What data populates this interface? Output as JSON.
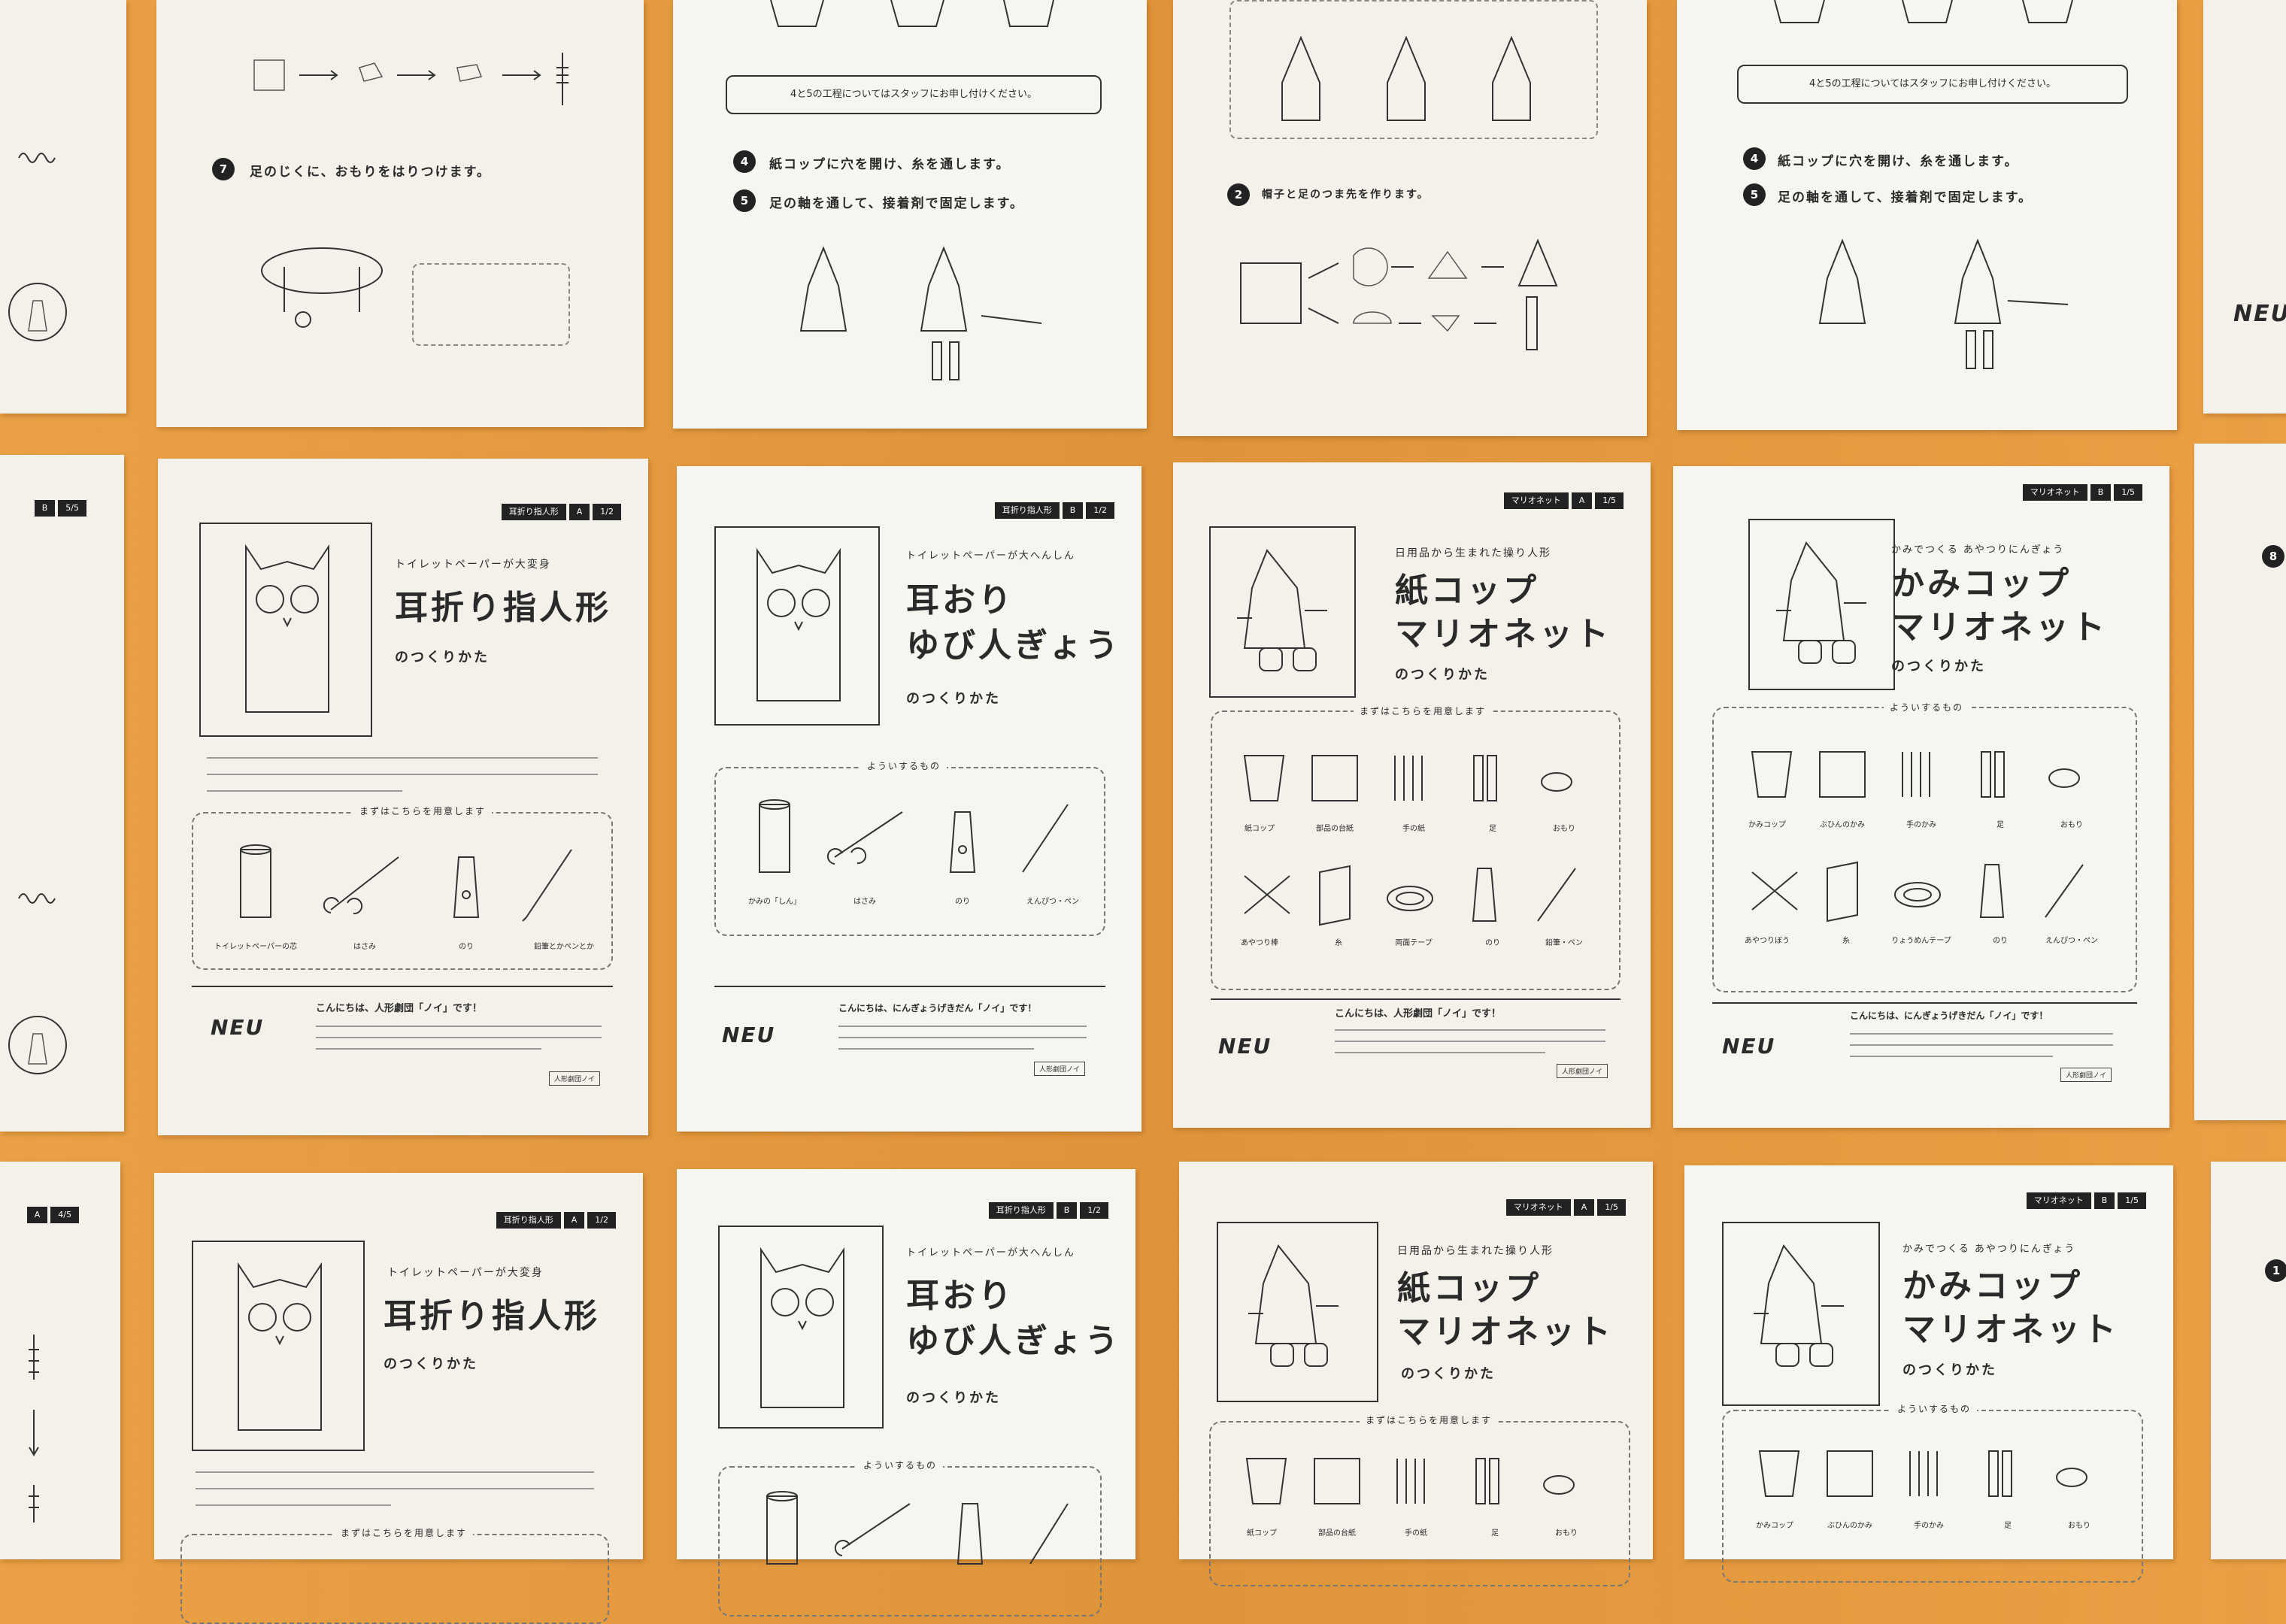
{
  "photo": {
    "background": "#e89a3c",
    "paper": "#f4f1ea"
  },
  "sheet_owl_a": {
    "tag_name": "耳折り指人形",
    "tag_variant": "A",
    "tag_page": "1/2",
    "subtitle": "トイレットペーパーが大変身",
    "title": "耳折り指人形",
    "howto": "のつくりかた",
    "box_label": "まずはこちらを用意します",
    "items": [
      "トイレットペーパーの芯",
      "はさみ",
      "のり",
      "鉛筆とかペンとか"
    ],
    "greeting": "こんにちは、人形劇団「ノイ」です！",
    "logo": "NEU",
    "badge": "人形劇団ノイ"
  },
  "sheet_owl_b": {
    "tag_name": "耳折り指人形",
    "tag_variant": "B",
    "tag_page": "1/2",
    "subtitle": "トイレットペーパーが大へんしん",
    "title_line1": "耳おり",
    "title_line2": "ゆび人ぎょう",
    "howto": "のつくりかた",
    "box_label": "よういするもの",
    "items": [
      "かみの「しん」",
      "はさみ",
      "のり",
      "えんぴつ・ペン"
    ],
    "greeting": "こんにちは、にんぎょうげきだん「ノイ」です！",
    "logo": "NEU",
    "badge": "人形劇団ノイ"
  },
  "sheet_cup_a": {
    "tag_name": "マリオネット",
    "tag_variant": "A",
    "tag_page": "1/5",
    "subtitle": "日用品から生まれた操り人形",
    "title_line1": "紙コップ",
    "title_line2": "マリオネット",
    "howto": "のつくりかた",
    "box_label": "まずはこちらを用意します",
    "items_row1": [
      "紙コップ",
      "部品の台紙",
      "手の紙",
      "足",
      "おもり"
    ],
    "items_row2": [
      "あやつり棒",
      "糸",
      "両面テープ",
      "のり",
      "鉛筆・ペン"
    ],
    "greeting": "こんにちは、人形劇団「ノイ」です！",
    "logo": "NEU",
    "badge": "人形劇団ノイ"
  },
  "sheet_cup_b": {
    "tag_name": "マリオネット",
    "tag_variant": "B",
    "tag_page": "1/5",
    "subtitle": "かみでつくる あやつりにんぎょう",
    "title_line1": "かみコップ",
    "title_line2": "マリオネット",
    "howto": "のつくりかた",
    "box_label": "よういするもの",
    "items_row1": [
      "かみコップ",
      "ぶひんのかみ",
      "手のかみ",
      "足",
      "おもり"
    ],
    "items_row2": [
      "あやつりぼう",
      "糸",
      "りょうめんテープ",
      "のり",
      "えんぴつ・ペン"
    ],
    "greeting": "こんにちは、にんぎょうげきだん「ノイ」です！",
    "logo": "NEU",
    "badge": "人形劇団ノイ"
  },
  "top_row": {
    "step7_num": "7",
    "step7_text": "足のじくに、おもりをはりつけます。",
    "note_a": "4と5の工程についてはスタッフにお申し付けください。",
    "step4_num": "4",
    "step4_text": "紙コップに穴を開け、糸を通します。",
    "step5_num": "5",
    "step5_text": "足の軸を通して、接着剤で固定します。",
    "step2_num": "2",
    "step2_text": "帽子と足のつま先を作ります。",
    "note_b": "4と5の工程についてはスタッフにお申し付けください。",
    "step4b_text": "紙コップに穴を開け、糸を通します。",
    "step5b_text": "足の軸を通して、接着剤で固定します。"
  },
  "edge_sheets": {
    "left_mid_tag_variant": "B",
    "left_mid_tag_page": "5/5",
    "left_bot_tag_variant": "A",
    "left_bot_tag_page": "4/5",
    "right_mid_step": "8",
    "right_bot_step": "1"
  }
}
